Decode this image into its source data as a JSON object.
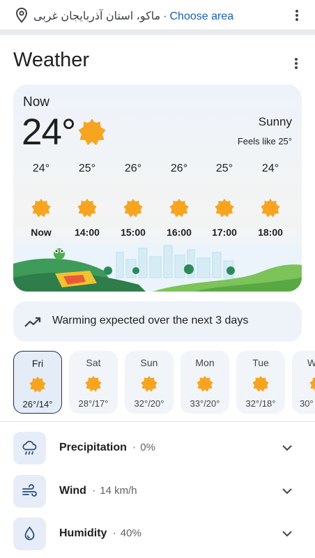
{
  "location": {
    "place": "ماکو، استان آذربایجان غربی",
    "separator": "·",
    "choose_area": "Choose area",
    "pin_icon": "location-pin-icon"
  },
  "weather": {
    "title": "Weather",
    "now": {
      "label": "Now",
      "temperature": "24°",
      "condition": "Sunny",
      "feels_like": "Feels like 25°"
    },
    "hourly": [
      {
        "temp": "24°",
        "time": "Now",
        "icon": "sunny"
      },
      {
        "temp": "25°",
        "time": "14:00",
        "icon": "sunny"
      },
      {
        "temp": "26°",
        "time": "15:00",
        "icon": "sunny"
      },
      {
        "temp": "26°",
        "time": "16:00",
        "icon": "sunny"
      },
      {
        "temp": "25°",
        "time": "17:00",
        "icon": "sunny"
      },
      {
        "temp": "24°",
        "time": "18:00",
        "icon": "sunny"
      }
    ],
    "insight": {
      "icon": "trending-up-icon",
      "text": "Warming expected over the next 3 days"
    },
    "daily": [
      {
        "day": "Fri",
        "range": "26°/14°",
        "icon": "sunny",
        "selected": true
      },
      {
        "day": "Sat",
        "range": "28°/17°",
        "icon": "sunny",
        "selected": false
      },
      {
        "day": "Sun",
        "range": "32°/20°",
        "icon": "sunny",
        "selected": false
      },
      {
        "day": "Mon",
        "range": "33°/20°",
        "icon": "sunny",
        "selected": false
      },
      {
        "day": "Tue",
        "range": "32°/18°",
        "icon": "sunny",
        "selected": false
      },
      {
        "day": "W",
        "range": "30°",
        "icon": "sunny",
        "selected": false
      }
    ],
    "metrics": [
      {
        "label": "Precipitation",
        "value": "0%",
        "icon": "rain-cloud-icon"
      },
      {
        "label": "Wind",
        "value": "14 km/h",
        "icon": "wind-icon"
      },
      {
        "label": "Humidity",
        "value": "40%",
        "icon": "water-drop-icon"
      }
    ]
  },
  "colors": {
    "sun": "#f5a623",
    "accent": "#1a5fb4",
    "card": "#eef3fa",
    "selected_border": "#1f2f4f"
  }
}
